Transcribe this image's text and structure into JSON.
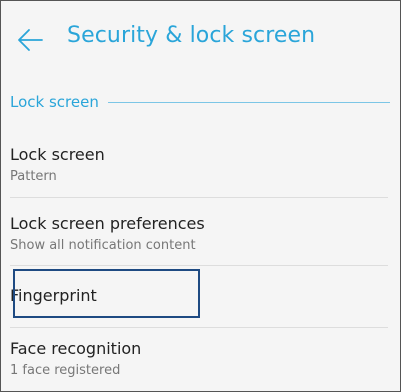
{
  "header": {
    "title": "Security & lock screen"
  },
  "section": {
    "title": "Lock screen"
  },
  "items": [
    {
      "title": "Lock screen",
      "summary": "Pattern"
    },
    {
      "title": "Lock screen preferences",
      "summary": "Show all notification content"
    },
    {
      "title": "Fingerprint",
      "summary": ""
    },
    {
      "title": "Face recognition",
      "summary": "1 face registered"
    }
  ],
  "colors": {
    "accent": "#2aa5d9",
    "focus": "#1e4a82",
    "background": "#f5f5f5"
  },
  "icons": {
    "back": "back-arrow-icon"
  }
}
